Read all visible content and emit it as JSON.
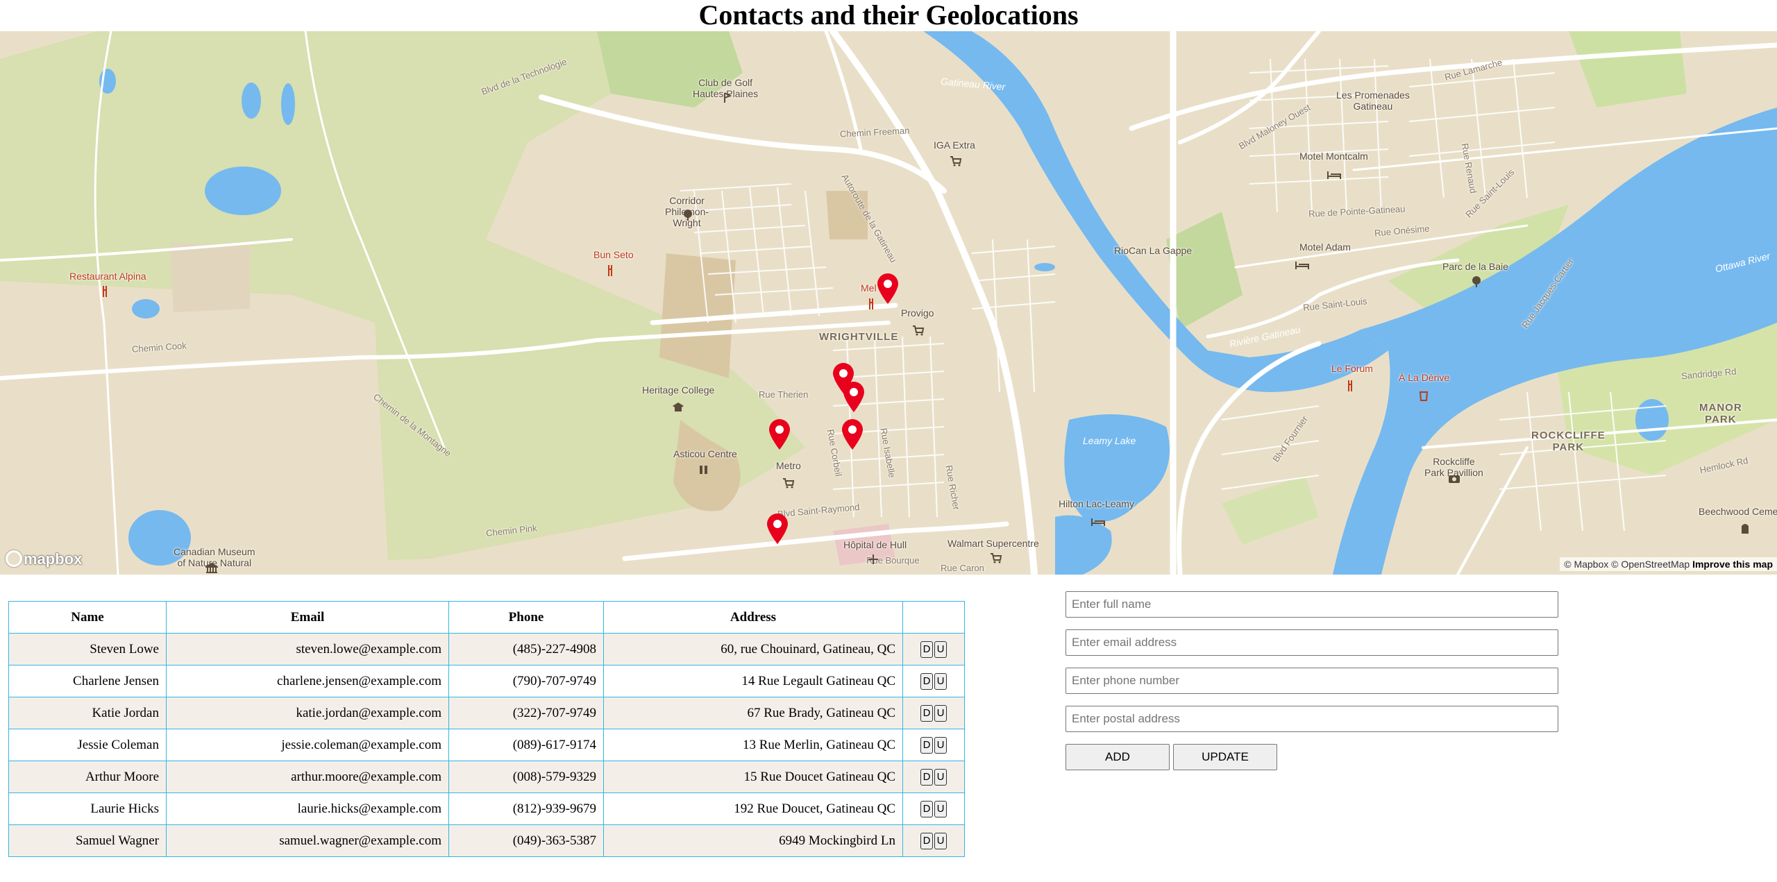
{
  "title": "Contacts and their Geolocations",
  "map": {
    "labels": {
      "club_golf": "Club de Golf\nHautes Plaines",
      "iga": "IGA Extra",
      "corridor": "Corridor\nPhilemon-\nWright",
      "bun_seto": "Bun Seto",
      "restaurant_alpina": "Restaurant Alpina",
      "wrightville": "WRIGHTVILLE",
      "provigo": "Provigo",
      "heritage": "Heritage College",
      "asticou": "Asticou Centre",
      "metro": "Metro",
      "hopital": "Hôpital de Hull",
      "walmart": "Walmart Supercentre",
      "canadian_museum": "Canadian Museum\nof Nature Natural",
      "promenades": "Les Promenades\nGatineau",
      "motel_montcalm": "Motel Montcalm",
      "motel_adam": "Motel Adam",
      "riocan": "RioCan La Gappe",
      "parc_baie": "Parc de la Baie",
      "le_forum": "Le Forum",
      "a_la_derive": "À La Dérive",
      "leamy_lake": "Leamy Lake",
      "hilton": "Hilton Lac-Leamy",
      "rockcliffe_pav": "Rockcliffe\nPark Pavillion",
      "rockcliffe_park": "ROCKCLIFFE\nPARK",
      "manor_park": "MANOR\nPARK",
      "beechwood": "Beechwood Cemet",
      "gatineau_river": "Gatineau River",
      "riviere_gatineau": "Rivière Gatineau",
      "ottawa_river": "Ottawa River",
      "chemin_cook": "Chemin Cook",
      "chemin_pink": "Chemin Pink",
      "chemin_freeman": "Chemin Freeman",
      "blvd_saint_raymond": "Blvd Saint-Raymond",
      "blvd_maloney": "Blvd Maloney Ouest",
      "rue_saint_louis": "Rue Saint-Louis",
      "rue_therien": "Rue Therien",
      "rue_bourque": "Rue Bourque",
      "rue_caron": "Rue Caron",
      "autoroute": "Autoroute de la Gatineau",
      "chemin_montagne": "Chemin de la Montagne",
      "blvd_fournier": "Blvd Fournier",
      "blvd_tech": "Blvd de la Technologie",
      "rue_pointe_gatineau": "Rue de Pointe-Gatineau",
      "rue_onesime": "Rue Onésime",
      "rue_jacques_cartier": "Rue Jacques-Cartier",
      "hemlock": "Hemlock Rd",
      "sandridge": "Sandridge Rd",
      "rue_isabelle": "Rue Isabelle",
      "rue_corbeil": "Rue Corbeil",
      "rue_richer": "Rue Richer",
      "rue_lamarche": "Rue Lamarche",
      "rue_renaud": "Rue Renaud",
      "rue_saint_louis_2": "Rue Saint-Louis",
      "melo": "Mel"
    },
    "mapbox_logo": "mapbox",
    "attribution": "© Mapbox © OpenStreetMap",
    "improve": "Improve this map"
  },
  "table": {
    "headers": [
      "Name",
      "Email",
      "Phone",
      "Address",
      ""
    ],
    "rows": [
      {
        "name": "Steven Lowe",
        "email": "steven.lowe@example.com",
        "phone": "(485)-227-4908",
        "address": "60, rue Chouinard, Gatineau, QC"
      },
      {
        "name": "Charlene Jensen",
        "email": "charlene.jensen@example.com",
        "phone": "(790)-707-9749",
        "address": "14 Rue Legault Gatineau QC"
      },
      {
        "name": "Katie Jordan",
        "email": "katie.jordan@example.com",
        "phone": "(322)-707-9749",
        "address": "67 Rue Brady, Gatineau QC"
      },
      {
        "name": "Jessie Coleman",
        "email": "jessie.coleman@example.com",
        "phone": "(089)-617-9174",
        "address": "13 Rue Merlin, Gatineau QC"
      },
      {
        "name": "Arthur Moore",
        "email": "arthur.moore@example.com",
        "phone": "(008)-579-9329",
        "address": "15 Rue Doucet Gatineau QC"
      },
      {
        "name": "Laurie Hicks",
        "email": "laurie.hicks@example.com",
        "phone": "(812)-939-9679",
        "address": "192 Rue Doucet, Gatineau QC"
      },
      {
        "name": "Samuel Wagner",
        "email": "samuel.wagner@example.com",
        "phone": "(049)-363-5387",
        "address": "6949 Mockingbird Ln"
      }
    ],
    "delete_label": "D",
    "update_label": "U"
  },
  "form": {
    "name_placeholder": "Enter full name",
    "email_placeholder": "Enter email address",
    "phone_placeholder": "Enter phone number",
    "address_placeholder": "Enter postal address",
    "add_label": "ADD",
    "update_label": "UPDATE"
  },
  "colors": {
    "water": "#75b9ef",
    "land": "#e9dfc8",
    "park": "#d6e3b0",
    "road": "#ffffff",
    "pin": "#e8001c",
    "table_border": "#33b5e5"
  },
  "icons": [
    "map-pin-icon",
    "restaurant-icon",
    "shopping-cart-icon",
    "hotel-icon",
    "tree-icon",
    "museum-icon",
    "hospital-icon",
    "golf-icon",
    "school-icon",
    "camera-icon"
  ]
}
